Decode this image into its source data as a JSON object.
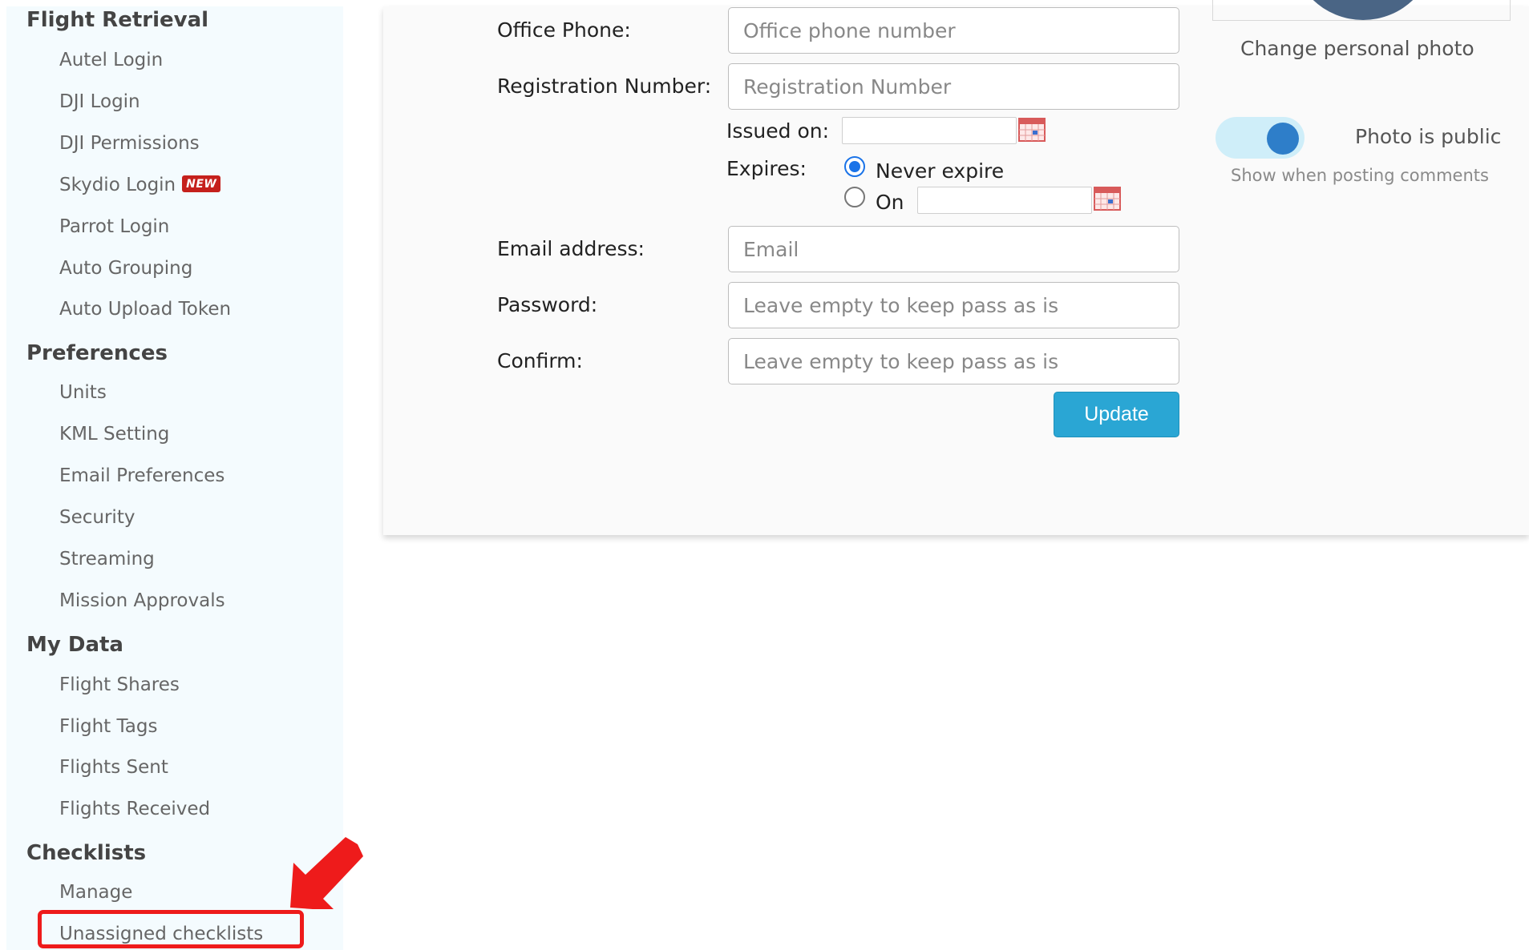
{
  "sidebar": {
    "sections": [
      {
        "title": "Flight Retrieval",
        "items": [
          "Autel Login",
          "DJI Login",
          "DJI Permissions",
          "Skydio Login",
          "Parrot Login",
          "Auto Grouping",
          "Auto Upload Token"
        ]
      },
      {
        "title": "Preferences",
        "items": [
          "Units",
          "KML Setting",
          "Email Preferences",
          "Security",
          "Streaming",
          "Mission Approvals"
        ]
      },
      {
        "title": "My Data",
        "items": [
          "Flight Shares",
          "Flight Tags",
          "Flights Sent",
          "Flights Received"
        ]
      },
      {
        "title": "Checklists",
        "items": [
          "Manage",
          "Unassigned checklists"
        ]
      }
    ],
    "new_badge": "NEW"
  },
  "form": {
    "office_phone": {
      "label": "Office Phone:",
      "value": "",
      "placeholder": "Office phone number"
    },
    "registration": {
      "label": "Registration Number:",
      "value": "",
      "placeholder": "Registration Number"
    },
    "issued_on": {
      "label": "Issued on:",
      "value": ""
    },
    "expires": {
      "label": "Expires:",
      "never_label": "Never expire",
      "on_label": "On",
      "selected": "never",
      "on_date": ""
    },
    "email": {
      "label": "Email address:",
      "value": "",
      "placeholder": "Email"
    },
    "password": {
      "label": "Password:",
      "value": "",
      "placeholder": "Leave empty to keep pass as is"
    },
    "confirm": {
      "label": "Confirm:",
      "value": "",
      "placeholder": "Leave empty to keep pass as is"
    },
    "update_label": "Update"
  },
  "profile": {
    "change_photo_label": "Change personal photo",
    "photo_public_label": "Photo is public",
    "photo_public_hint": "Show when posting comments",
    "photo_public_on": true
  },
  "colors": {
    "accent": "#2aa6d4",
    "highlight": "#ee1b1b",
    "toggle_knob": "#2e7ec9"
  },
  "annotation": {
    "arrow_icon": "red-arrow-icon",
    "highlighted_item": "Unassigned checklists"
  }
}
